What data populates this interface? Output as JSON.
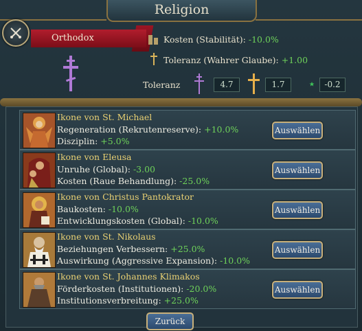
{
  "window": {
    "title": "Religion"
  },
  "religion": {
    "name": "Orthodox",
    "icon": "orthodox-cross-icon"
  },
  "stats": {
    "cost_label": "Kosten (Stabilität):",
    "cost_value": "-10.0%",
    "tolerance_label": "Toleranz (Wahrer Glaube):",
    "tolerance_value": "+1.00"
  },
  "tolerance": {
    "label": "Toleranz",
    "true_faith": "4.7",
    "heretic": "1.7",
    "heathen": "-0.2"
  },
  "icons": [
    {
      "title": "Ikone von St. Michael",
      "line1_label": "Regeneration (Rekrutenreserve):",
      "line1_value": "+10.0%",
      "line2_label": "Disziplin:",
      "line2_value": "+5.0%",
      "button": "Auswählen"
    },
    {
      "title": "Ikone von Eleusa",
      "line1_label": "Unruhe (Global):",
      "line1_value": "-3.00",
      "line2_label": "Kosten (Raue Behandlung):",
      "line2_value": "-25.0%",
      "button": "Auswählen"
    },
    {
      "title": "Ikone von Christus Pantokrator",
      "line1_label": "Baukosten:",
      "line1_value": "-10.0%",
      "line2_label": "Entwicklungskosten (Global):",
      "line2_value": "-10.0%",
      "button": "Auswählen"
    },
    {
      "title": "Ikone von St. Nikolaus",
      "line1_label": "Beziehungen Verbessern:",
      "line1_value": "+25.0%",
      "line2_label": "Auswirkung (Aggressive Expansion):",
      "line2_value": "-10.0%",
      "button": "Auswählen"
    },
    {
      "title": "Ikone von St. Johannes Klimakos",
      "line1_label": "Förderkosten (Institutionen):",
      "line1_value": "-20.0%",
      "line2_label": "Institutionsverbreitung:",
      "line2_value": "+25.0%",
      "button": "Auswählen"
    }
  ],
  "footer": {
    "back": "Zurück"
  }
}
